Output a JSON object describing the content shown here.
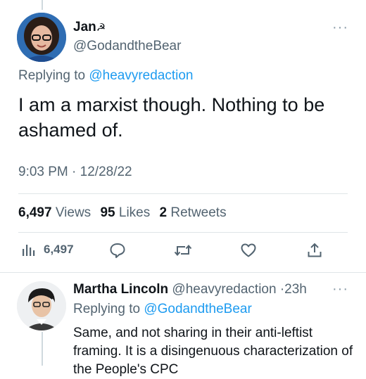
{
  "tweet": {
    "author_name": "Jan",
    "author_name_emoji": "☭",
    "author_handle": "@GodandtheBear",
    "replying_prefix": "Replying to",
    "replying_to": "@heavyredaction",
    "text": "I am a marxist though. Nothing to be ashamed of.",
    "time": "9:03 PM",
    "date_sep": "·",
    "date": "12/28/22",
    "views_count": "6,497",
    "views_label": "Views",
    "likes_count": "95",
    "likes_label": "Likes",
    "retweets_count": "2",
    "retweets_label": "Retweets",
    "more_label": "···"
  },
  "actions": {
    "views_icon": "analytics-icon",
    "views_count": "6,497",
    "reply_icon": "reply-icon",
    "retweet_icon": "retweet-icon",
    "like_icon": "heart-icon",
    "share_icon": "share-icon"
  },
  "reply": {
    "author_name": "Martha Lincoln",
    "author_handle": "@heavyredaction",
    "sep": "·",
    "time_ago": "23h",
    "replying_prefix": "Replying to",
    "replying_to": "@GodandtheBear",
    "text": "Same, and not sharing in their anti-leftist framing. It is a disingenuous characterization of the People's CPC",
    "more_label": "···"
  },
  "colors": {
    "link": "#1d9bf0",
    "muted": "#536471",
    "text": "#0f1419"
  }
}
